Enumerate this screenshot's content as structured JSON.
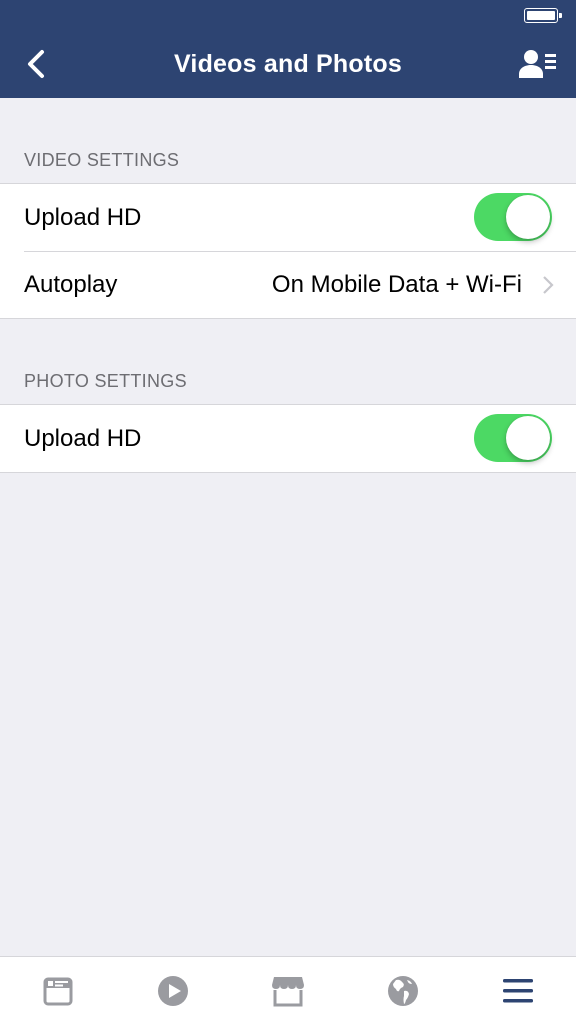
{
  "navbar": {
    "title": "Videos and Photos",
    "back_icon": "chevron-left-icon",
    "right_icon": "profile-list-icon",
    "background_color": "#2d4472"
  },
  "status_bar": {
    "battery_icon": "battery-full-icon"
  },
  "sections": [
    {
      "header": "VIDEO SETTINGS",
      "rows": [
        {
          "label": "Upload HD",
          "type": "toggle",
          "on": true
        },
        {
          "label": "Autoplay",
          "type": "disclosure",
          "value": "On Mobile Data + Wi-Fi"
        }
      ]
    },
    {
      "header": "PHOTO SETTINGS",
      "rows": [
        {
          "label": "Upload HD",
          "type": "toggle",
          "on": true
        }
      ]
    }
  ],
  "toggle_color": "#4cd964",
  "tabbar": {
    "tabs": [
      {
        "icon": "news-feed-icon",
        "active": false
      },
      {
        "icon": "video-play-icon",
        "active": false
      },
      {
        "icon": "marketplace-icon",
        "active": false
      },
      {
        "icon": "globe-notifications-icon",
        "active": false
      },
      {
        "icon": "menu-icon",
        "active": true
      }
    ],
    "inactive_color": "#9a9ba0",
    "active_color": "#2d4472"
  }
}
